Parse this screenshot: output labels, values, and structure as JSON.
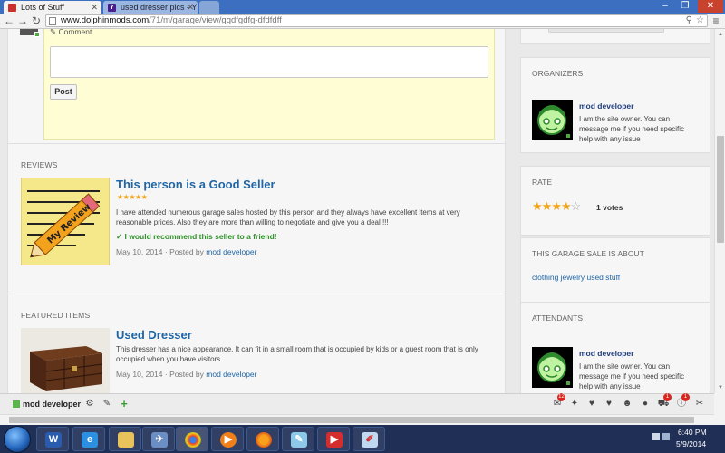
{
  "browser": {
    "tabs": [
      {
        "title": "Lots of Stuff",
        "active": true
      },
      {
        "title": "used dresser pics - Y",
        "active": false
      }
    ],
    "url_host": "www.dolphinmods.com",
    "url_path": "/71/m/garage/view/ggdfgdfg-dfdfdff"
  },
  "comment": {
    "label": "Comment",
    "post_label": "Post"
  },
  "reviews": {
    "section_title": "REVIEWS",
    "title": "This person is a Good Seller",
    "stars": "★★★★★",
    "text": "I have attended numerous garage sales hosted by this person and they always have excellent items at very reasonable prices. Also they are more than willing to negotiate and give you a deal !!!",
    "recommend": "I would recommend this seller to a friend!",
    "date": "May 10, 2014",
    "posted_by_label": "Posted by",
    "posted_by": "mod developer",
    "image_text": "My Review"
  },
  "featured": {
    "section_title": "FEATURED ITEMS",
    "title": "Used Dresser",
    "text": "This dresser has a nice appearance. It can fit in a small room that is occupied by kids or a guest room that is only occupied when you have visitors.",
    "date": "May 10, 2014",
    "posted_by_label": "Posted by",
    "posted_by": "mod developer"
  },
  "sidebar": {
    "organizers_title": "ORGANIZERS",
    "organizer_name": "mod developer",
    "organizer_desc": "I am the site owner. You can message me if you need specific help with any issue",
    "rate_title": "RATE",
    "rating": 4,
    "rating_max": 5,
    "votes": "1 votes",
    "about_title": "THIS GARAGE SALE IS ABOUT",
    "about_tags": "clothing jewelry used stuff",
    "attendants_title": "ATTENDANTS",
    "attendant_name": "mod developer",
    "attendant_desc": "I am the site owner. You can message me if you need specific help with any issue"
  },
  "stickybar": {
    "user": "mod developer",
    "badge_messages": "12",
    "badge_cart": "1",
    "badge_info": "1"
  },
  "taskbar": {
    "time": "6:40 PM",
    "date": "5/9/2014"
  },
  "colors": {
    "link_blue": "#2066a5",
    "star_orange": "#f2a71a",
    "recommend_green": "#2f8f2a",
    "comment_yellow": "#fffdd3",
    "badge_red": "#d7261f"
  }
}
